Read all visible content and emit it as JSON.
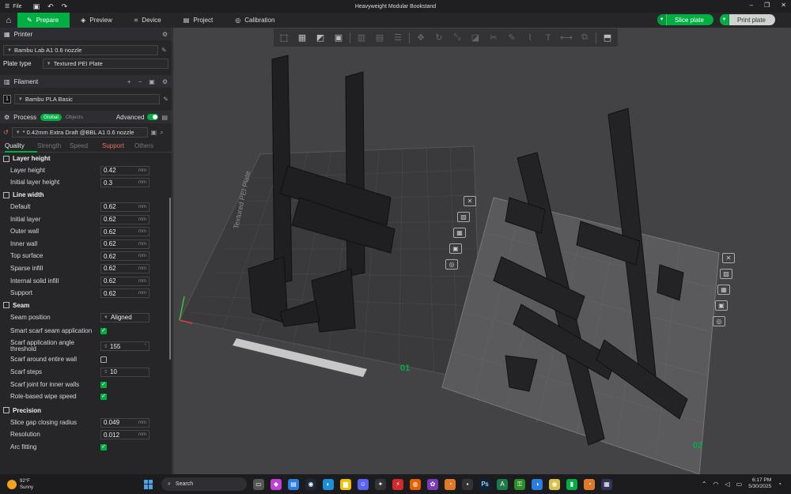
{
  "titlebar": {
    "menu_label": "File",
    "app_title": "Heavyweight Modular Bookstand"
  },
  "tabs": [
    {
      "label": "Prepare",
      "icon": "prepare-icon",
      "active": true
    },
    {
      "label": "Preview",
      "icon": "preview-icon"
    },
    {
      "label": "Device",
      "icon": "device-icon"
    },
    {
      "label": "Project",
      "icon": "project-icon"
    },
    {
      "label": "Calibration",
      "icon": "calibration-icon"
    }
  ],
  "actions": {
    "slice_label": "Slice plate",
    "print_label": "Print plate"
  },
  "printer": {
    "section_label": "Printer",
    "preset": "Bambu Lab A1 0.6 nozzle",
    "plate_type_label": "Plate type",
    "plate_type_value": "Textured PEI Plate"
  },
  "filament": {
    "section_label": "Filament",
    "slot": "1",
    "preset": "Bambu PLA Basic"
  },
  "process": {
    "section_label": "Process",
    "global_label": "Global",
    "objects_label": "Objects",
    "advanced_label": "Advanced",
    "preset": "* 0.42mm Extra Draft @BBL A1 0.6 nozzle"
  },
  "quality_tabs": [
    "Quality",
    "Strength",
    "Speed",
    "Support",
    "Others"
  ],
  "groups": {
    "layer_height": {
      "title": "Layer height",
      "rows": [
        {
          "label": "Layer height",
          "value": "0.42",
          "unit": "mm"
        },
        {
          "label": "Initial layer height",
          "value": "0.3",
          "unit": "mm"
        }
      ]
    },
    "line_width": {
      "title": "Line width",
      "rows": [
        {
          "label": "Default",
          "value": "0.62",
          "unit": "mm"
        },
        {
          "label": "Initial layer",
          "value": "0.62",
          "unit": "mm"
        },
        {
          "label": "Outer wall",
          "value": "0.62",
          "unit": "mm"
        },
        {
          "label": "Inner wall",
          "value": "0.62",
          "unit": "mm"
        },
        {
          "label": "Top surface",
          "value": "0.62",
          "unit": "mm"
        },
        {
          "label": "Sparse infill",
          "value": "0.62",
          "unit": "mm"
        },
        {
          "label": "Internal solid infill",
          "value": "0.62",
          "unit": "mm"
        },
        {
          "label": "Support",
          "value": "0.62",
          "unit": "mm"
        }
      ]
    },
    "seam": {
      "title": "Seam",
      "seam_position_label": "Seam position",
      "seam_position_value": "Aligned",
      "smart_scarf_label": "Smart scarf seam application",
      "scarf_angle_label": "Scarf application angle threshold",
      "scarf_angle_value": "155",
      "scarf_angle_unit": "°",
      "scarf_entire_label": "Scarf around entire wall",
      "scarf_steps_label": "Scarf steps",
      "scarf_steps_value": "10",
      "scarf_inner_label": "Scarf joint for inner walls",
      "role_wipe_label": "Role-based wipe speed"
    },
    "precision": {
      "title": "Precision",
      "rows": [
        {
          "label": "Slice gap closing radius",
          "value": "0.049",
          "unit": "mm"
        },
        {
          "label": "Resolution",
          "value": "0.012",
          "unit": "mm"
        }
      ],
      "arc_fitting_label": "Arc fitting"
    }
  },
  "viewport": {
    "plate1_label": "Textured PEI Plate",
    "plate1_number": "01",
    "plate2_number": "02"
  },
  "taskbar": {
    "temperature": "92°F",
    "condition": "Sunny",
    "search_placeholder": "Search",
    "time": "6:17 PM",
    "date": "5/30/2025"
  }
}
